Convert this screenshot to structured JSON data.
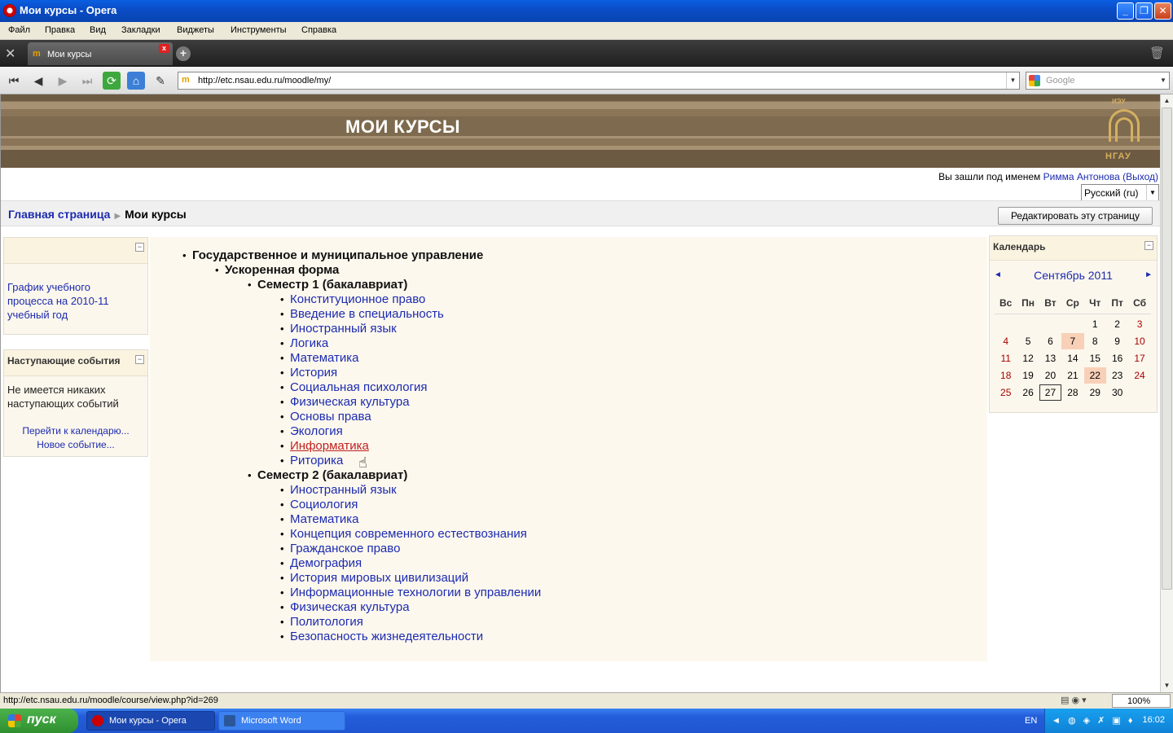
{
  "window": {
    "title": "Мои курсы - Opera",
    "controls": [
      "_",
      "❐",
      "✕"
    ]
  },
  "menu": [
    "Файл",
    "Правка",
    "Вид",
    "Закладки",
    "Виджеты",
    "Инструменты",
    "Справка"
  ],
  "tab": {
    "label": "Мои курсы",
    "icon_text": "m",
    "close": "x",
    "new_tab": "+"
  },
  "address": {
    "url": "http://etc.nsau.edu.ru/moodle/my/",
    "search_placeholder": "Google"
  },
  "page": {
    "heading": "МОИ КУРСЫ",
    "logo_top": "ИЭУ",
    "logo_text": "НГАУ",
    "login_prefix": "Вы зашли под именем ",
    "user_name": "Римма Антонова",
    "logout": "(Выход)",
    "language": "Русский (ru)",
    "breadcrumb_home": "Главная страница",
    "breadcrumb_sep": "▶",
    "breadcrumb_current": "Мои курсы",
    "edit_button": "Редактировать эту страницу"
  },
  "blocks": {
    "left1": {
      "title": "",
      "link": "График учебного процесса на 2010-11 учебный год"
    },
    "events": {
      "title": "Наступающие события",
      "text": "Не имеется никаких наступающих событий",
      "link_calendar": "Перейти к календарю...",
      "link_new": "Новое событие..."
    },
    "calendar": {
      "title": "Календарь",
      "month": "Сентябрь 2011",
      "prev": "◄",
      "next": "►",
      "weekdays": [
        "Вс",
        "Пн",
        "Вт",
        "Ср",
        "Чт",
        "Пт",
        "Сб"
      ],
      "weeks": [
        [
          "",
          "",
          "",
          "",
          "1",
          "2",
          "3"
        ],
        [
          "4",
          "5",
          "6",
          "7",
          "8",
          "9",
          "10"
        ],
        [
          "11",
          "12",
          "13",
          "14",
          "15",
          "16",
          "17"
        ],
        [
          "18",
          "19",
          "20",
          "21",
          "22",
          "23",
          "24"
        ],
        [
          "25",
          "26",
          "27",
          "28",
          "29",
          "30",
          ""
        ]
      ],
      "event_days": [
        "7",
        "22"
      ],
      "today": "27"
    }
  },
  "courses": {
    "program": "Государственное и муниципальное управление",
    "form": "Ускоренная форма",
    "semesters": [
      {
        "name": "Семестр 1 (бакалавриат)",
        "courses": [
          "Конституционное право",
          "Введение в специальность",
          "Иностранный язык",
          "Логика",
          "Математика",
          "История",
          "Социальная психология",
          "Физическая культура",
          "Основы права",
          "Экология",
          "Информатика",
          "Риторика"
        ]
      },
      {
        "name": "Семестр 2 (бакалавриат)",
        "courses": [
          "Иностранный язык",
          "Социология",
          "Математика",
          "Концепция современного естествознания",
          "Гражданское право",
          "Демография",
          "История мировых цивилизаций",
          "Информационные технологии в управлении",
          "Физическая культура",
          "Политология",
          "Безопасность жизнедеятельности"
        ]
      }
    ]
  },
  "status": {
    "url": "http://etc.nsau.edu.ru/moodle/course/view.php?id=269",
    "zoom": "100%"
  },
  "taskbar": {
    "start": "пуск",
    "items": [
      "Мои курсы - Opera",
      "Microsoft Word"
    ],
    "lang": "EN",
    "clock": "16:02"
  }
}
